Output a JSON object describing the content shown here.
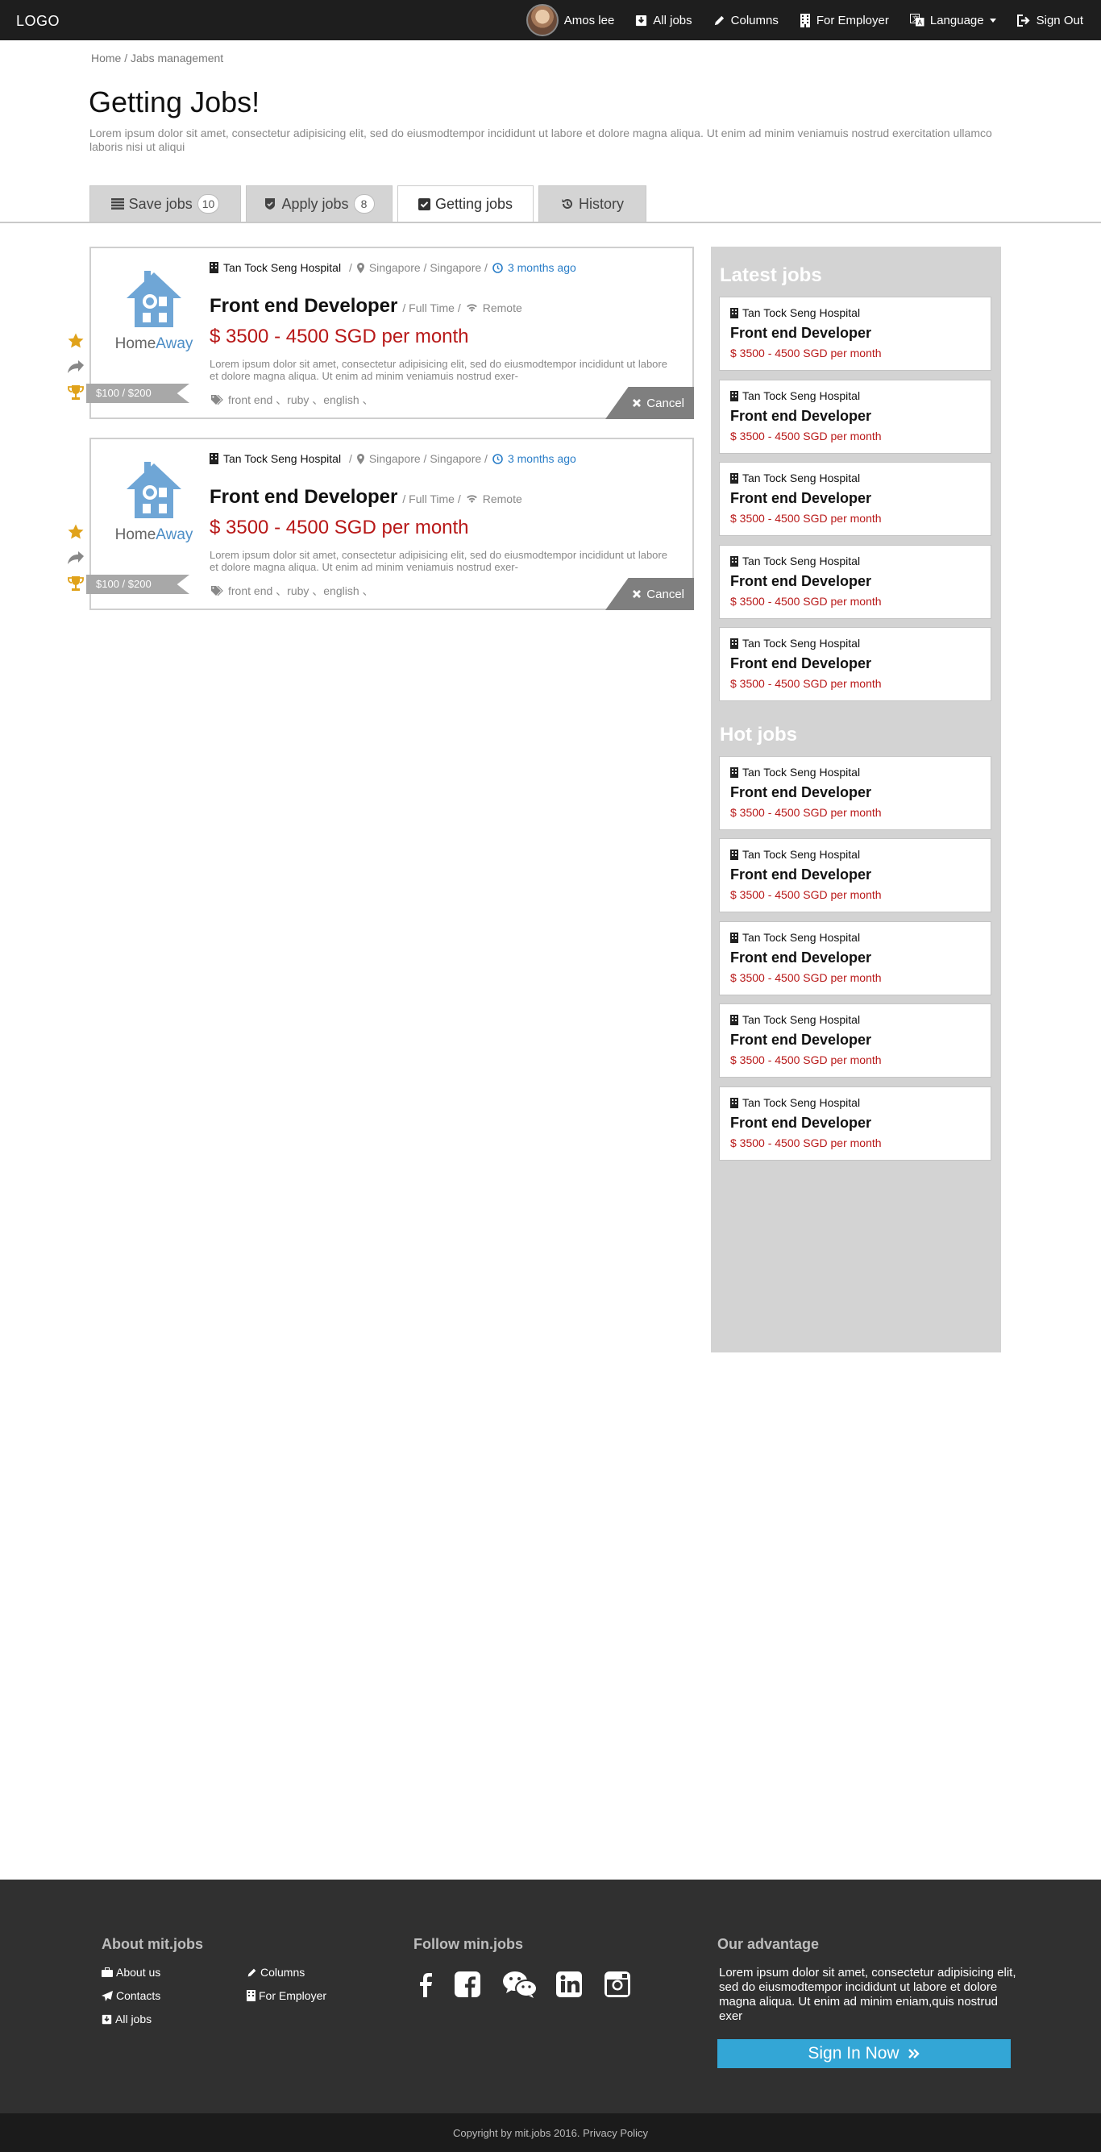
{
  "header": {
    "logo": "LOGO",
    "user_name": "Amos lee",
    "nav": [
      {
        "label": "All jobs",
        "icon": "download-icon"
      },
      {
        "label": "Columns",
        "icon": "pencil-icon"
      },
      {
        "label": "For Employer",
        "icon": "building-icon"
      },
      {
        "label": "Language",
        "icon": "translate-icon"
      },
      {
        "label": "Sign Out",
        "icon": "sign-out-icon"
      }
    ]
  },
  "breadcrumb": "Home / Jabs management",
  "page": {
    "title": "Getting Jobs!",
    "description": "Lorem ipsum dolor sit amet, consectetur adipisicing elit, sed do eiusmodtempor incididunt ut labore et dolore magna aliqua. Ut enim ad minim veniamuis nostrud exercitation ullamco laboris nisi ut aliqui"
  },
  "tabs": [
    {
      "label": "Save jobs",
      "count": "10",
      "icon": "list-icon",
      "active": false
    },
    {
      "label": "Apply jobs",
      "count": "8",
      "icon": "shield-check-icon",
      "active": false
    },
    {
      "label": "Getting jobs",
      "count": "",
      "icon": "check-square-icon",
      "active": true
    },
    {
      "label": "History",
      "count": "",
      "icon": "history-icon",
      "active": false
    }
  ],
  "jobs": [
    {
      "company_logo_text": "HomeAway",
      "company": "Tan Tock Seng Hospital",
      "location": "Singapore / Singapore /",
      "posted": "3 months ago",
      "title": "Front end Developer",
      "type": "/ Full Time /",
      "remote": "Remote",
      "salary": "$ 3500 - 4500  SGD per month",
      "description": "Lorem ipsum dolor sit amet, consectetur adipisicing elit, sed do eiusmodtempor incididunt ut labore et dolore magna aliqua. Ut enim ad minim veniamuis nostrud exer-",
      "tags": "front end 、ruby 、english 、",
      "price_range": "$100 / $200",
      "cancel_label": "Cancel"
    },
    {
      "company_logo_text": "HomeAway",
      "company": "Tan Tock Seng Hospital",
      "location": "Singapore / Singapore /",
      "posted": "3 months ago",
      "title": "Front end Developer",
      "type": "/ Full Time /",
      "remote": "Remote",
      "salary": "$ 3500 - 4500  SGD per month",
      "description": "Lorem ipsum dolor sit amet, consectetur adipisicing elit, sed do eiusmodtempor incididunt ut labore et dolore magna aliqua. Ut enim ad minim veniamuis nostrud exer-",
      "tags": "front end 、ruby 、english 、",
      "price_range": "$100 / $200",
      "cancel_label": "Cancel"
    }
  ],
  "sidebar": {
    "latest_heading": "Latest jobs",
    "latest": [
      {
        "company": "Tan Tock Seng Hospital",
        "title": "Front end Developer",
        "salary": "$ 3500 - 4500 SGD per month"
      },
      {
        "company": "Tan Tock Seng Hospital",
        "title": "Front end Developer",
        "salary": "$ 3500 - 4500 SGD per month"
      },
      {
        "company": "Tan Tock Seng Hospital",
        "title": "Front end Developer",
        "salary": "$ 3500 - 4500 SGD per month"
      },
      {
        "company": "Tan Tock Seng Hospital",
        "title": "Front end Developer",
        "salary": "$ 3500 - 4500 SGD per month"
      },
      {
        "company": "Tan Tock Seng Hospital",
        "title": "Front end Developer",
        "salary": "$ 3500 - 4500 SGD per month"
      }
    ],
    "hot_heading": "Hot jobs",
    "hot": [
      {
        "company": "Tan Tock Seng Hospital",
        "title": "Front end Developer",
        "salary": "$ 3500 - 4500 SGD per month"
      },
      {
        "company": "Tan Tock Seng Hospital",
        "title": "Front end Developer",
        "salary": "$ 3500 - 4500 SGD per month"
      },
      {
        "company": "Tan Tock Seng Hospital",
        "title": "Front end Developer",
        "salary": "$ 3500 - 4500 SGD per month"
      },
      {
        "company": "Tan Tock Seng Hospital",
        "title": "Front end Developer",
        "salary": "$ 3500 - 4500 SGD per month"
      },
      {
        "company": "Tan Tock Seng Hospital",
        "title": "Front end Developer",
        "salary": "$ 3500 - 4500 SGD per month"
      }
    ]
  },
  "footer": {
    "about_heading": "About mit.jobs",
    "about_links": [
      {
        "label": "About us",
        "icon": "briefcase-icon"
      },
      {
        "label": "Columns",
        "icon": "pencil-icon"
      },
      {
        "label": "Contacts",
        "icon": "paper-plane-icon"
      },
      {
        "label": "For Employer",
        "icon": "building-icon"
      },
      {
        "label": "All jobs",
        "icon": "download-icon"
      }
    ],
    "follow_heading": "Follow min.jobs",
    "social": [
      "facebook-icon",
      "facebook-square-icon",
      "wechat-icon",
      "linkedin-icon",
      "instagram-icon"
    ],
    "advantage_heading": "Our advantage",
    "advantage_text": "Lorem ipsum dolor sit amet, consectetur adipisicing elit, sed do eiusmodtempor incididunt ut labore et dolore magna aliqua. Ut enim ad minim eniam,quis nostrud exer",
    "signin_label": "Sign In Now",
    "copyright": "Copyright by mit.jobs 2016. Privacy Policy"
  },
  "colors": {
    "topbar": "#1e1e1e",
    "salary_red": "#b81818",
    "link_blue": "#2a7ec8",
    "star_gold": "#e0a21a",
    "sidebar_bg": "#d3d3d3",
    "footer_bg": "#303030",
    "signin_blue": "#33a6d6"
  }
}
